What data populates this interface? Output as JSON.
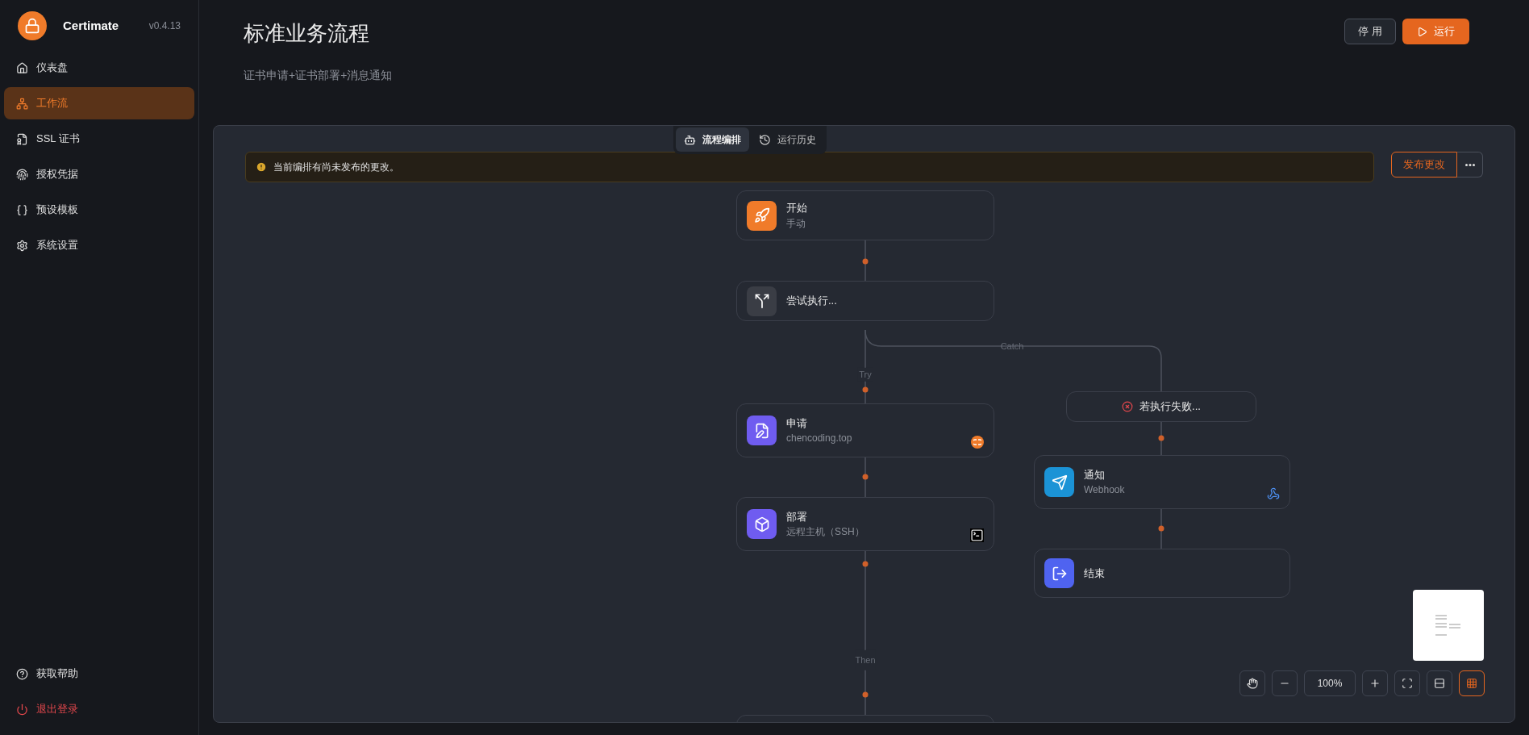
{
  "brand": {
    "name": "Certimate",
    "version": "v0.4.13"
  },
  "sidebar": {
    "items": [
      {
        "kind": "dashboard",
        "label": "仪表盘",
        "selected": false
      },
      {
        "kind": "workflow",
        "label": "工作流",
        "selected": true
      },
      {
        "kind": "certificate",
        "label": "SSL 证书",
        "selected": false
      },
      {
        "kind": "access",
        "label": "授权凭据",
        "selected": false
      },
      {
        "kind": "preset",
        "label": "预设模板",
        "selected": false
      },
      {
        "kind": "settings",
        "label": "系统设置",
        "selected": false
      }
    ],
    "footer": [
      {
        "kind": "help",
        "label": "获取帮助"
      },
      {
        "kind": "logout",
        "label": "退出登录"
      }
    ]
  },
  "header": {
    "title": "标准业务流程",
    "subtitle": "证书申请+证书部署+消息通知",
    "buttons": [
      {
        "kind": "disable",
        "label": "停 用"
      },
      {
        "kind": "run",
        "label": "运行"
      }
    ]
  },
  "tabs": [
    {
      "kind": "design",
      "label": "流程编排",
      "selected": true
    },
    {
      "kind": "history",
      "label": "运行历史",
      "selected": false
    }
  ],
  "notice": {
    "text": "当前编排有尚未发布的更改。",
    "publish_label": "发布更改"
  },
  "flow": {
    "main": [
      {
        "kind": "start",
        "title": "开始",
        "subtitle": "手动"
      },
      {
        "kind": "try",
        "title": "尝试执行..."
      },
      {
        "kind": "apply",
        "title": "申请",
        "subtitle": "chencoding.top"
      },
      {
        "kind": "deploy",
        "title": "部署",
        "subtitle": "远程主机（SSH）"
      }
    ],
    "catch": {
      "title": "若执行失败...",
      "nodes": [
        {
          "kind": "notify",
          "title": "通知",
          "subtitle": "Webhook"
        },
        {
          "kind": "end",
          "title": "结束"
        }
      ]
    },
    "labels": {
      "try": "Try",
      "catch": "Catch",
      "then": "Then"
    }
  },
  "controls": {
    "zoom": "100%",
    "toggles": [
      {
        "kind": "pan",
        "selected": false
      },
      {
        "kind": "minimap",
        "selected": true
      }
    ]
  }
}
